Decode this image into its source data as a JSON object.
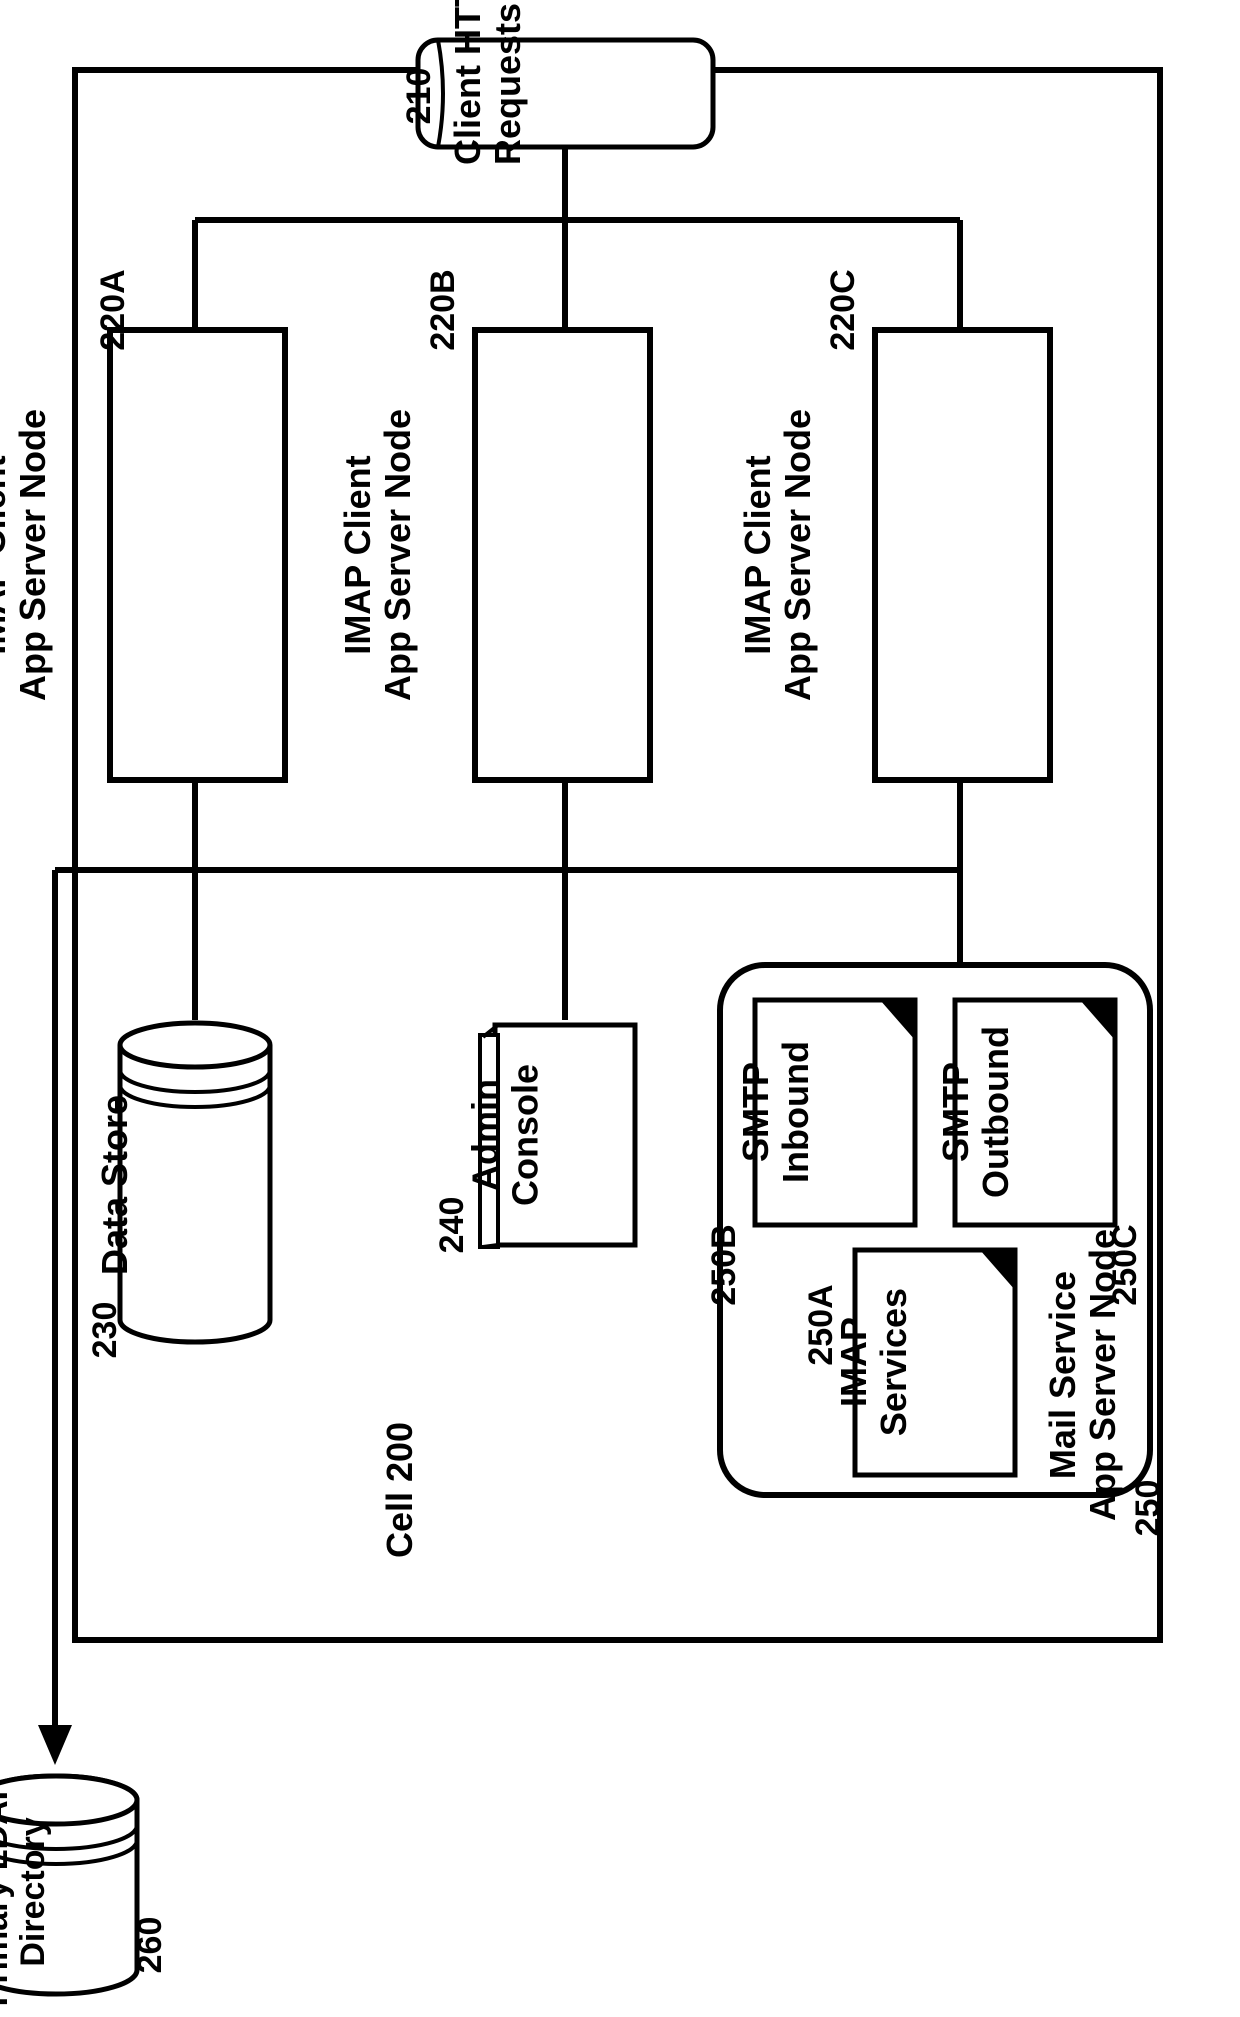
{
  "cell": {
    "label": "Cell 200"
  },
  "client_http": {
    "label": "Client HTTP\nRequests",
    "ref": "210"
  },
  "imap_nodes": {
    "a": {
      "label": "IMAP Client\nApp Server Node",
      "ref": "220A"
    },
    "b": {
      "label": "IMAP Client\nApp Server Node",
      "ref": "220B"
    },
    "c": {
      "label": "IMAP Client\nApp Server Node",
      "ref": "220C"
    }
  },
  "data_store": {
    "label": "Data Store",
    "ref": "230"
  },
  "admin_console": {
    "label": "Admin\nConsole",
    "ref": "240"
  },
  "mail_service": {
    "label": "Mail Service\nApp Server Node",
    "ref": "250",
    "imap_services": {
      "label": "IMAP\nServices",
      "ref": "250A"
    },
    "smtp_inbound": {
      "label": "SMTP\nInbound",
      "ref": "250B"
    },
    "smtp_outbound": {
      "label": "SMTP\nOutbound",
      "ref": "250C"
    }
  },
  "ldap": {
    "label": "Primary LDAP\nDirectory",
    "ref": "260"
  }
}
